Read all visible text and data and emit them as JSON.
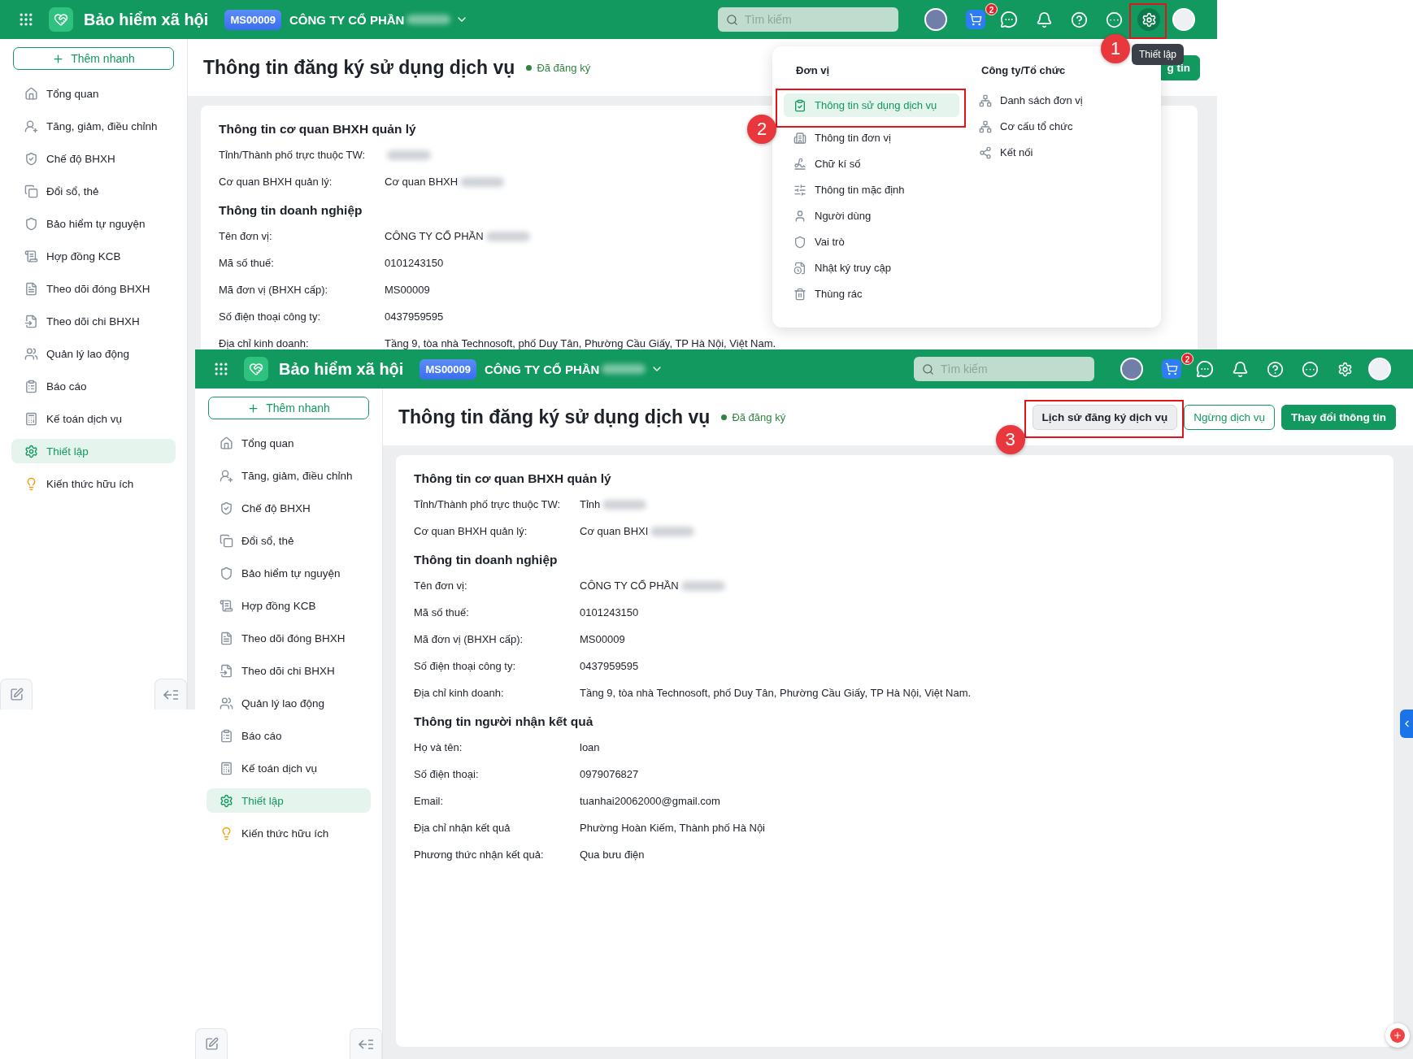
{
  "screens": [
    {
      "kind": "back",
      "header": {
        "app_title": "Bảo hiểm xã hội",
        "unit_code": "MS00009",
        "company": "CÔNG TY CỔ PHẦN",
        "company_redacted": true,
        "search": {
          "placeholder": "Tìm kiếm"
        },
        "cart_count": "2",
        "settings_active": true,
        "settings_marker": "1"
      },
      "sidebar": {
        "quick_add": "Thêm nhanh",
        "items": [
          {
            "label": "Tổng quan",
            "selected": false
          },
          {
            "label": "Tăng, giảm, điều chỉnh",
            "selected": false
          },
          {
            "label": "Chế độ BHXH",
            "selected": false
          },
          {
            "label": "Đổi sổ, thẻ",
            "selected": false
          },
          {
            "label": "Bảo hiểm tự nguyện",
            "selected": false
          },
          {
            "label": "Hợp đồng KCB",
            "selected": false
          },
          {
            "label": "Theo dõi đóng BHXH",
            "selected": false
          },
          {
            "label": "Theo dõi chi BHXH",
            "selected": false
          },
          {
            "label": "Quản lý lao động",
            "selected": false
          },
          {
            "label": "Báo cáo",
            "selected": false
          },
          {
            "label": "Kế toán dịch vụ",
            "selected": false
          },
          {
            "label": "Thiết lập",
            "selected": true
          },
          {
            "label": "Kiến thức hữu ích",
            "selected": false
          }
        ]
      },
      "page": {
        "title": "Thông tin đăng ký sử dụng dịch vụ",
        "status": "Đã đăng ký",
        "actions": [
          {
            "label": "g tin",
            "kind": "primary"
          }
        ],
        "sections": [
          {
            "title": "Thông tin cơ quan BHXH quản lý",
            "rows": [
              {
                "label": "Tỉnh/Thành phố trực thuộc TW:",
                "redacted": true
              },
              {
                "label": "Cơ quan BHXH quản lý:",
                "value": "Cơ quan BHXH",
                "redacted": true
              }
            ]
          },
          {
            "title": "Thông tin doanh nghiệp",
            "rows": [
              {
                "label": "Tên đơn vị:",
                "value": "CÔNG TY CỔ PHẦN",
                "redacted": true
              },
              {
                "label": "Mã số thuế:",
                "value": "0101243150",
                "redacted": false
              },
              {
                "label": "Mã đơn vị (BHXH cấp):",
                "value": "MS00009",
                "redacted": false
              },
              {
                "label": "Số điện thoại công ty:",
                "value": "0437959595",
                "redacted": false
              },
              {
                "label": "Địa chỉ kinh doanh:",
                "value": "Tầng 9, tòa nhà Technosoft, phố Duy Tân, Phường Cầu Giấy, TP Hà Nội, Việt Nam.",
                "redacted": false
              }
            ]
          }
        ]
      },
      "tooltip": "Thiết lập",
      "settings_menu": {
        "columns": [
          {
            "heading": "Đơn vị",
            "items": [
              {
                "label": "Thông tin sử dụng dịch vụ",
                "selected": true,
                "marker": "2"
              },
              {
                "label": "Thông tin đơn vị",
                "selected": false
              },
              {
                "label": "Chữ kí số",
                "selected": false
              },
              {
                "label": "Thông tin mặc định",
                "selected": false
              },
              {
                "label": "Người dùng",
                "selected": false
              },
              {
                "label": "Vai trò",
                "selected": false
              },
              {
                "label": "Nhật ký truy cập",
                "selected": false
              },
              {
                "label": "Thùng rác",
                "selected": false
              }
            ]
          },
          {
            "heading": "Công ty/Tổ chức",
            "items": [
              {
                "label": "Danh sách đơn vị",
                "selected": false
              },
              {
                "label": "Cơ cấu tổ chức",
                "selected": false
              },
              {
                "label": "Kết nối",
                "selected": false
              }
            ]
          }
        ]
      }
    },
    {
      "kind": "front",
      "header": {
        "app_title": "Bảo hiểm xã hội",
        "unit_code": "MS00009",
        "company": "CÔNG TY CỔ PHẦN",
        "company_redacted": true,
        "search": {
          "placeholder": "Tìm kiếm"
        },
        "cart_count": "2",
        "settings_active": false
      },
      "sidebar": {
        "quick_add": "Thêm nhanh",
        "items": [
          {
            "label": "Tổng quan",
            "selected": false
          },
          {
            "label": "Tăng, giảm, điều chỉnh",
            "selected": false
          },
          {
            "label": "Chế độ BHXH",
            "selected": false
          },
          {
            "label": "Đổi sổ, thẻ",
            "selected": false
          },
          {
            "label": "Bảo hiểm tự nguyện",
            "selected": false
          },
          {
            "label": "Hợp đồng KCB",
            "selected": false
          },
          {
            "label": "Theo dõi đóng BHXH",
            "selected": false
          },
          {
            "label": "Theo dõi chi BHXH",
            "selected": false
          },
          {
            "label": "Quản lý lao động",
            "selected": false
          },
          {
            "label": "Báo cáo",
            "selected": false
          },
          {
            "label": "Kế toán dịch vụ",
            "selected": false
          },
          {
            "label": "Thiết lập",
            "selected": true
          },
          {
            "label": "Kiến thức hữu ích",
            "selected": false
          }
        ]
      },
      "page": {
        "title": "Thông tin đăng ký sử dụng dịch vụ",
        "status": "Đã đăng ký",
        "actions": [
          {
            "label": "Lịch sử đăng ký dịch vụ",
            "kind": "secondary",
            "marker": "3"
          },
          {
            "label": "Ngừng dịch vụ",
            "kind": "outline"
          },
          {
            "label": "Thay đổi thông tin",
            "kind": "primary"
          }
        ],
        "sections": [
          {
            "title": "Thông tin cơ quan BHXH quản lý",
            "rows": [
              {
                "label": "Tỉnh/Thành phố trực thuộc TW:",
                "value": "Tỉnh",
                "redacted": true
              },
              {
                "label": "Cơ quan BHXH quản lý:",
                "value": "Cơ quan BHXI",
                "redacted": true
              }
            ]
          },
          {
            "title": "Thông tin doanh nghiệp",
            "rows": [
              {
                "label": "Tên đơn vị:",
                "value": "CÔNG TY CỔ PHẦN",
                "redacted": true
              },
              {
                "label": "Mã số thuế:",
                "value": "0101243150",
                "redacted": false
              },
              {
                "label": "Mã đơn vị (BHXH cấp):",
                "value": "MS00009",
                "redacted": false
              },
              {
                "label": "Số điện thoại công ty:",
                "value": "0437959595",
                "redacted": false
              },
              {
                "label": "Địa chỉ kinh doanh:",
                "value": "Tầng 9, tòa nhà Technosoft, phố Duy Tân, Phường Cầu Giấy, TP Hà Nội, Việt Nam.",
                "redacted": false
              }
            ]
          },
          {
            "title": "Thông tin người nhận kết quả",
            "rows": [
              {
                "label": "Họ và tên:",
                "value": "loan",
                "redacted": false
              },
              {
                "label": "Số điện thoại:",
                "value": "0979076827",
                "redacted": false
              },
              {
                "label": "Email:",
                "value": "tuanhai20062000@gmail.com",
                "redacted": false
              },
              {
                "label": "Địa chỉ nhận kết quả",
                "value": "Phường Hoàn Kiếm, Thành phố Hà Nội",
                "redacted": false
              },
              {
                "label": "Phương thức nhận kết quả:",
                "value": "Qua bưu điện",
                "redacted": false
              }
            ]
          }
        ]
      }
    }
  ]
}
